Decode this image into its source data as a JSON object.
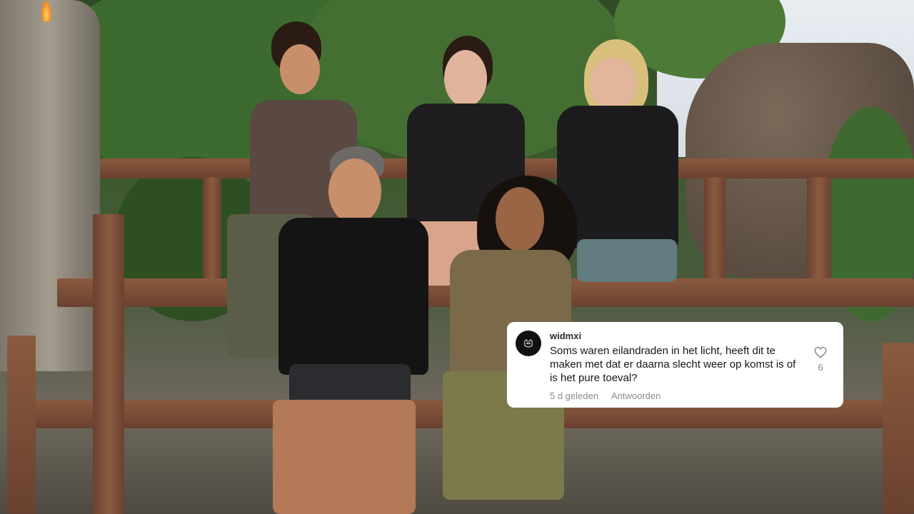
{
  "video": {
    "scene_description_icon": "campfire-torch-icon"
  },
  "comment": {
    "username": "widmxi",
    "text": "Soms waren eilandraden in het licht, heeft dit te maken met dat er daarna slecht weer op komst is of is het pure toeval?",
    "time_ago": "5 d geleden",
    "reply_label": "Antwoorden",
    "like_count": "6",
    "avatar_icon": "cat-avatar-icon",
    "like_icon": "heart-outline-icon"
  }
}
